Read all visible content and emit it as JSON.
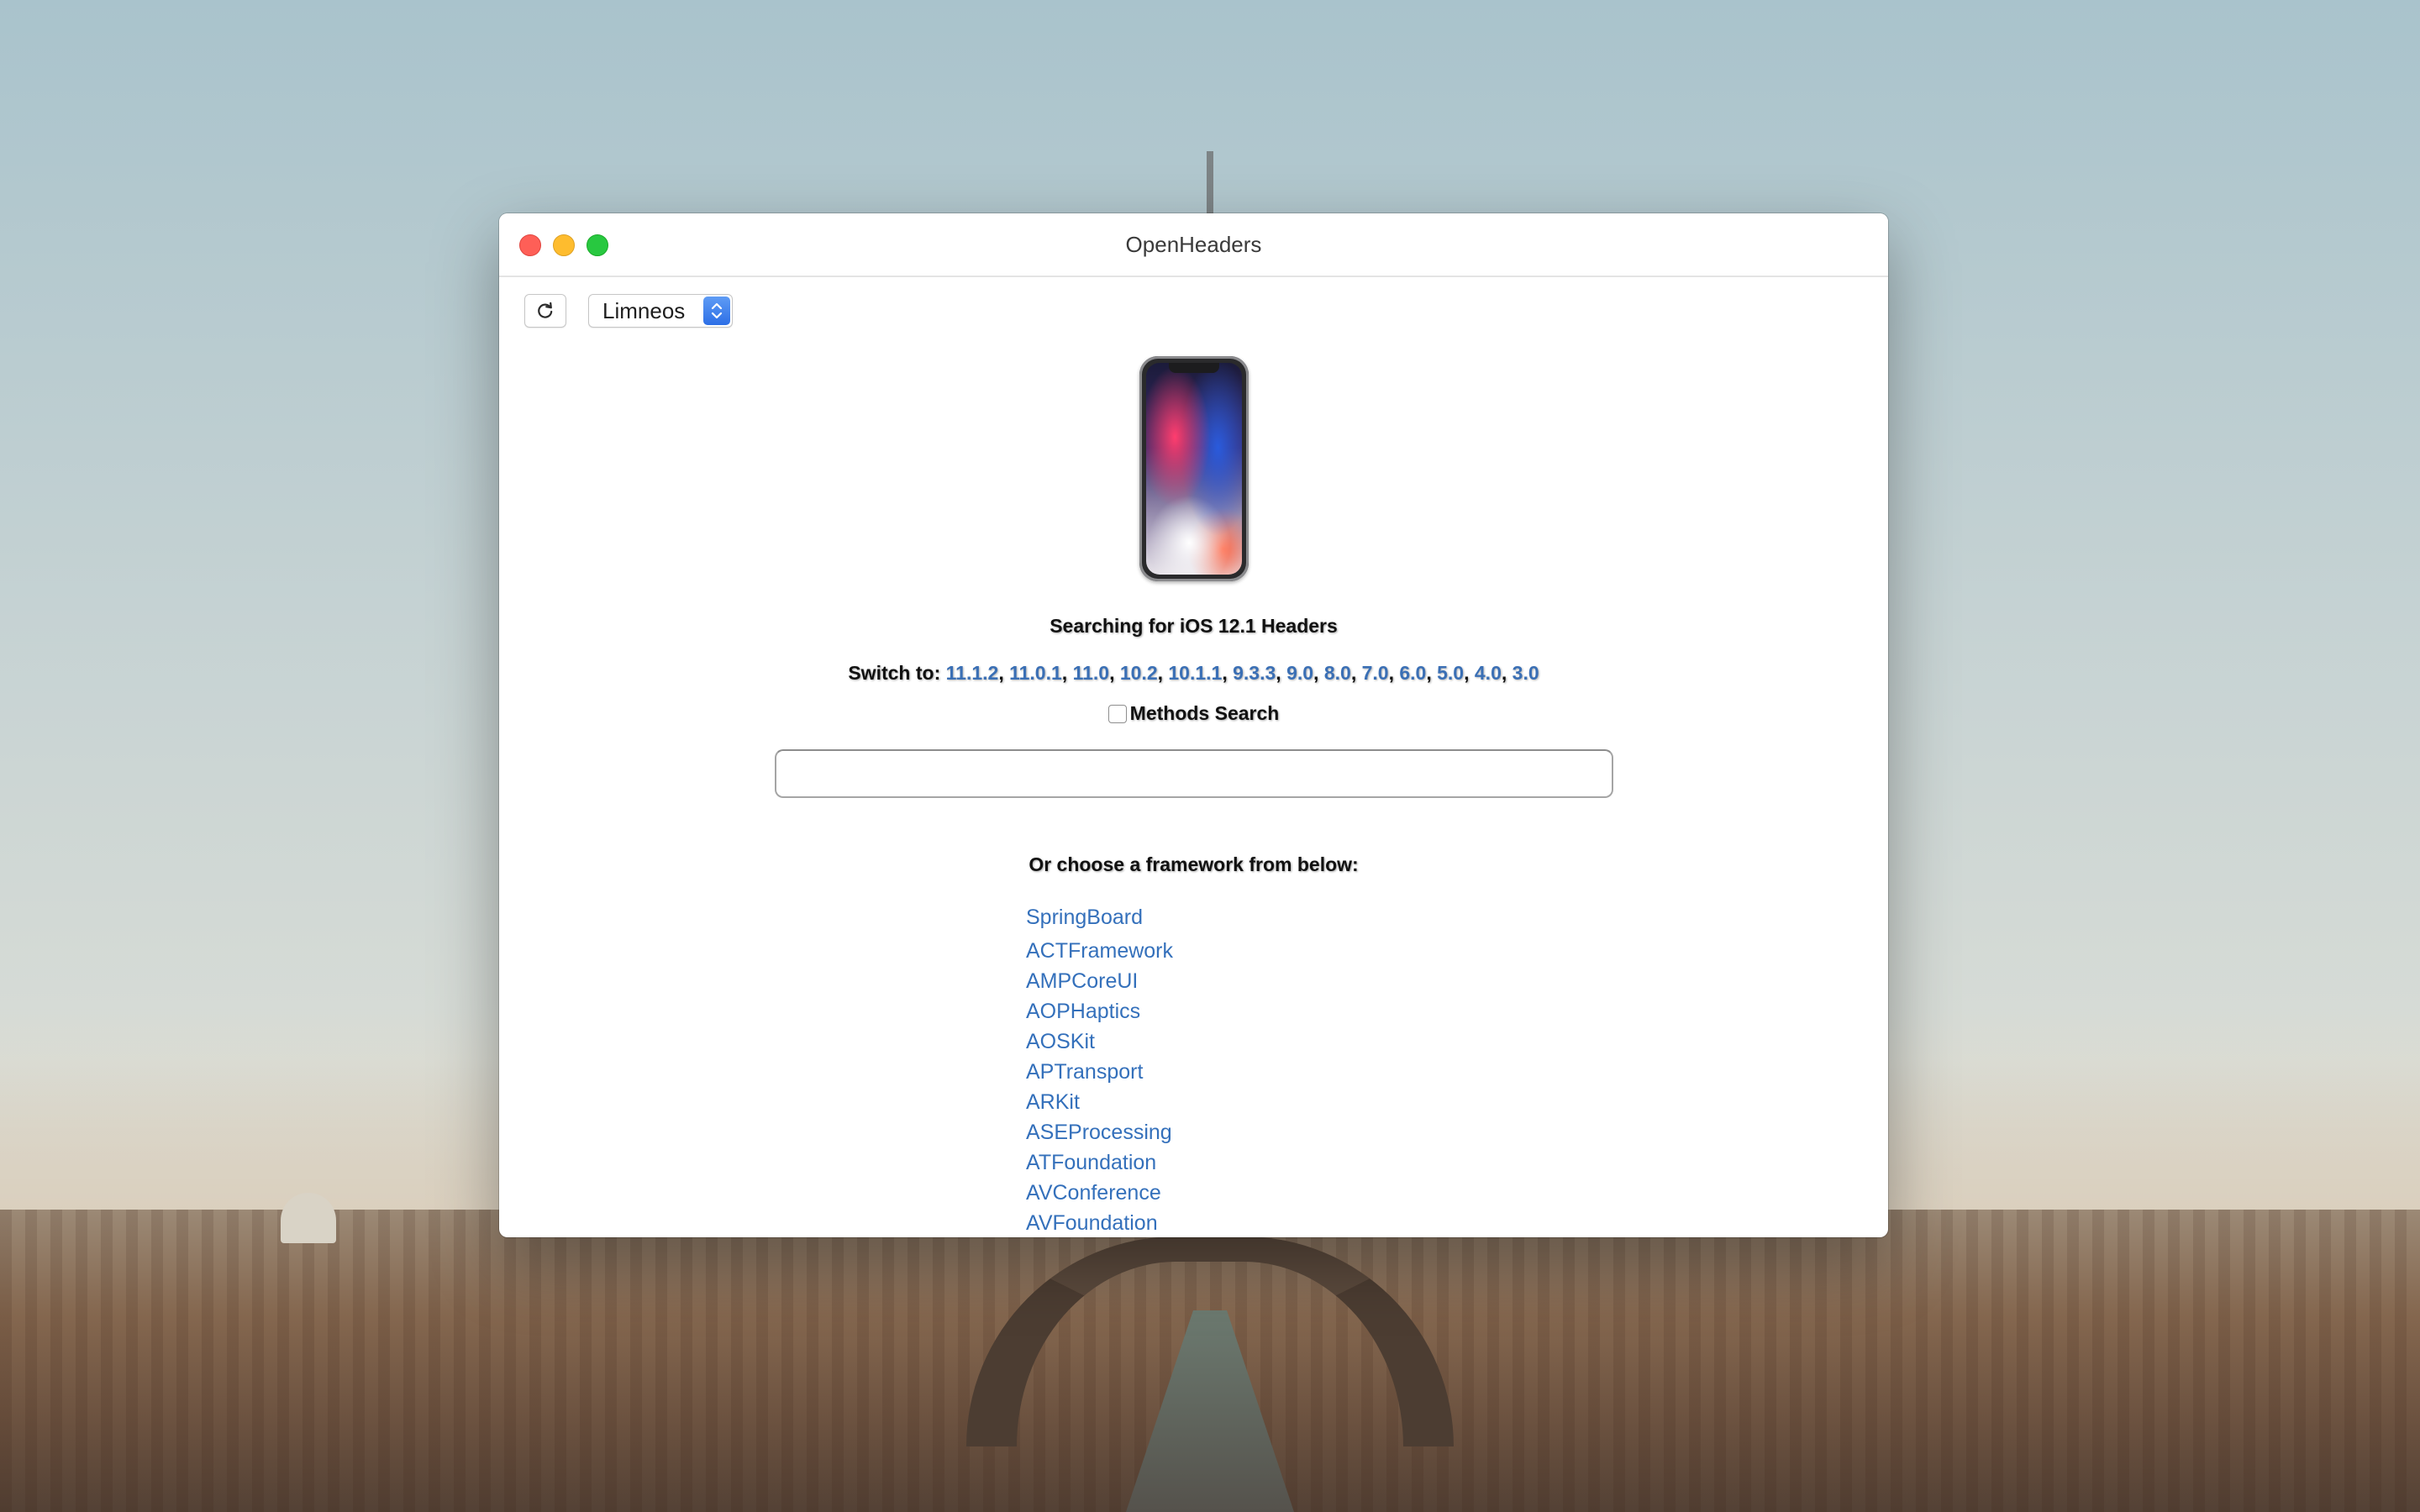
{
  "window": {
    "title": "OpenHeaders"
  },
  "toolbar": {
    "refresh_icon": "refresh-icon",
    "device_select_value": "Limneos",
    "select_arrows_icon": "updown-chevron-icon"
  },
  "device_image": "iphone-x-image",
  "main": {
    "searching_heading": "Searching for iOS 12.1 Headers",
    "switch_label": "Switch to:",
    "versions": [
      "11.1.2",
      "11.0.1",
      "11.0",
      "10.2",
      "10.1.1",
      "9.3.3",
      "9.0",
      "8.0",
      "7.0",
      "6.0",
      "5.0",
      "4.0",
      "3.0"
    ],
    "methods_search_label": "Methods Search",
    "methods_search_checked": false,
    "search_value": "",
    "choose_heading": "Or choose a framework from below:",
    "frameworks": [
      "SpringBoard",
      "ACTFramework",
      "AMPCoreUI",
      "AOPHaptics",
      "AOSKit",
      "APTransport",
      "ARKit",
      "ASEProcessing",
      "ATFoundation",
      "AVConference",
      "AVFoundation"
    ]
  },
  "colors": {
    "link": "#3470bb",
    "close": "#fe5f57",
    "minimize": "#febc2e",
    "zoom": "#28c840",
    "select_accent": "#2d6fe6"
  }
}
